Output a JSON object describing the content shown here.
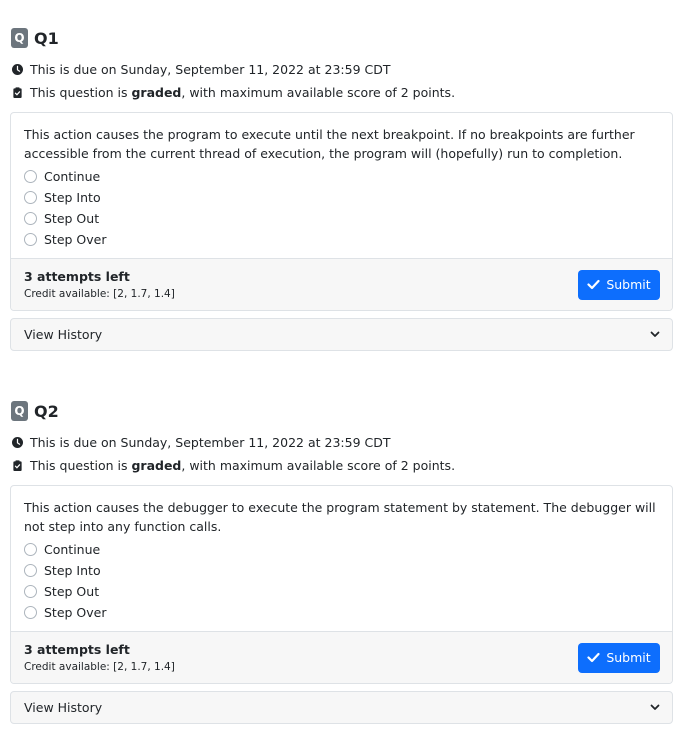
{
  "questions": [
    {
      "badge": "Q",
      "title": "Q1",
      "due_text": "This is due on Sunday, September 11, 2022 at 23:59 CDT",
      "graded_prefix": "This question is ",
      "graded_word": "graded",
      "graded_suffix": ", with maximum available score of 2 points.",
      "prompt": "This action causes the program to execute until the next breakpoint. If no breakpoints are further accessible from the current thread of execution, the program will (hopefully) run to completion.",
      "options": [
        "Continue",
        "Step Into",
        "Step Out",
        "Step Over"
      ],
      "attempts": "3 attempts left",
      "credit": "Credit available: [2, 1.7, 1.4]",
      "submit_label": "Submit",
      "history_label": "View History"
    },
    {
      "badge": "Q",
      "title": "Q2",
      "due_text": "This is due on Sunday, September 11, 2022 at 23:59 CDT",
      "graded_prefix": "This question is ",
      "graded_word": "graded",
      "graded_suffix": ", with maximum available score of 2 points.",
      "prompt": "This action causes the debugger to execute the program statement by statement. The debugger will not step into any function calls.",
      "options": [
        "Continue",
        "Step Into",
        "Step Out",
        "Step Over"
      ],
      "attempts": "3 attempts left",
      "credit": "Credit available: [2, 1.7, 1.4]",
      "submit_label": "Submit",
      "history_label": "View History"
    }
  ],
  "colors": {
    "badge": "#6c757d",
    "primary": "#0d6efd",
    "footer_bg": "#f7f7f7",
    "border": "#dee2e6"
  },
  "icons": {
    "due": "clock-icon",
    "graded": "clipboard-check-icon",
    "submit": "check-icon",
    "history": "chevron-down-icon"
  }
}
